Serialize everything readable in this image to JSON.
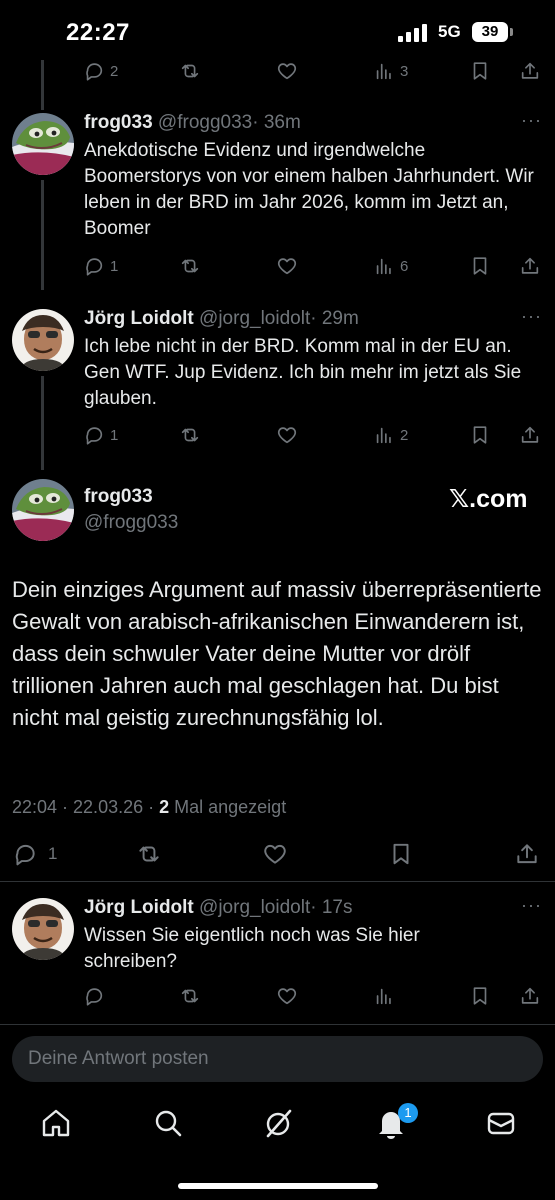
{
  "status": {
    "time": "22:27",
    "network": "5G",
    "battery": "39"
  },
  "top_actions": {
    "replies": "2",
    "views": "3"
  },
  "tweets": [
    {
      "name": "frog033",
      "handle": "@frogg033",
      "time": "· 36m",
      "text": "Anekdotische Evidenz und irgendwelche Boomerstorys von vor einem halben Jahrhundert. Wir leben in der BRD im Jahr 2026, komm im Jetzt an, Boomer",
      "replies": "1",
      "views": "6"
    },
    {
      "name": "Jörg Loidolt",
      "handle": "@jorg_loidolt",
      "time": "· 29m",
      "text": "Ich lebe nicht in der BRD. Komm mal in der EU an. Gen WTF.  Jup Evidenz. Ich bin mehr im jetzt als Sie glauben.",
      "replies": "1",
      "views": "2"
    }
  ],
  "main_tweet": {
    "name": "frog033",
    "handle": "@frogg033",
    "watermark": "𝕏.com",
    "text": "Dein einziges Argument auf massiv überrepräsentierte Gewalt von arabisch-afrikanischen Einwanderern ist, dass dein schwuler Vater deine Mutter vor drölf trillionen Jahren auch mal geschlagen hat. Du bist nicht mal geistig zurechnungsfähig lol.",
    "datetime": "22:04 · 22.03.26 · ",
    "view_count": "2",
    "views_label": " Mal angezeigt",
    "replies": "1"
  },
  "reply_tweet": {
    "name": "Jörg Loidolt",
    "handle": "@jorg_loidolt",
    "time": "· 17s",
    "text": "Wissen Sie eigentlich noch was Sie hier schreiben?"
  },
  "compose": {
    "placeholder": "Deine Antwort posten"
  },
  "nav": {
    "notifications_badge": "1"
  },
  "colors": {
    "accent": "#1d9bf0",
    "muted": "#71767b",
    "background": "#000000"
  }
}
